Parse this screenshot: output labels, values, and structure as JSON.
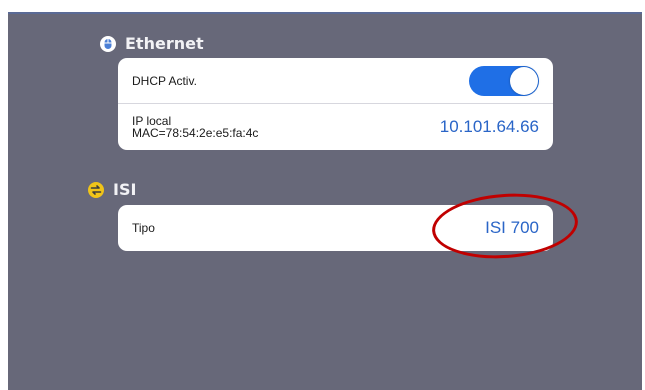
{
  "ethernet": {
    "title": "Ethernet",
    "icon": "mouse-icon",
    "dhcp": {
      "label": "DHCP Activ.",
      "enabled": true
    },
    "ip": {
      "label": "IP local",
      "mac": "MAC=78:54:2e:e5:fa:4c",
      "value": "10.101.64.66"
    }
  },
  "isi": {
    "title": "ISI",
    "icon": "swap-icon",
    "tipo": {
      "label": "Tipo",
      "value": "ISI 700"
    }
  },
  "colors": {
    "background": "#676879",
    "accent": "#1f6fe6",
    "value_text": "#2a65c7",
    "isi_icon": "#f0c419",
    "annotation": "#c00000"
  }
}
